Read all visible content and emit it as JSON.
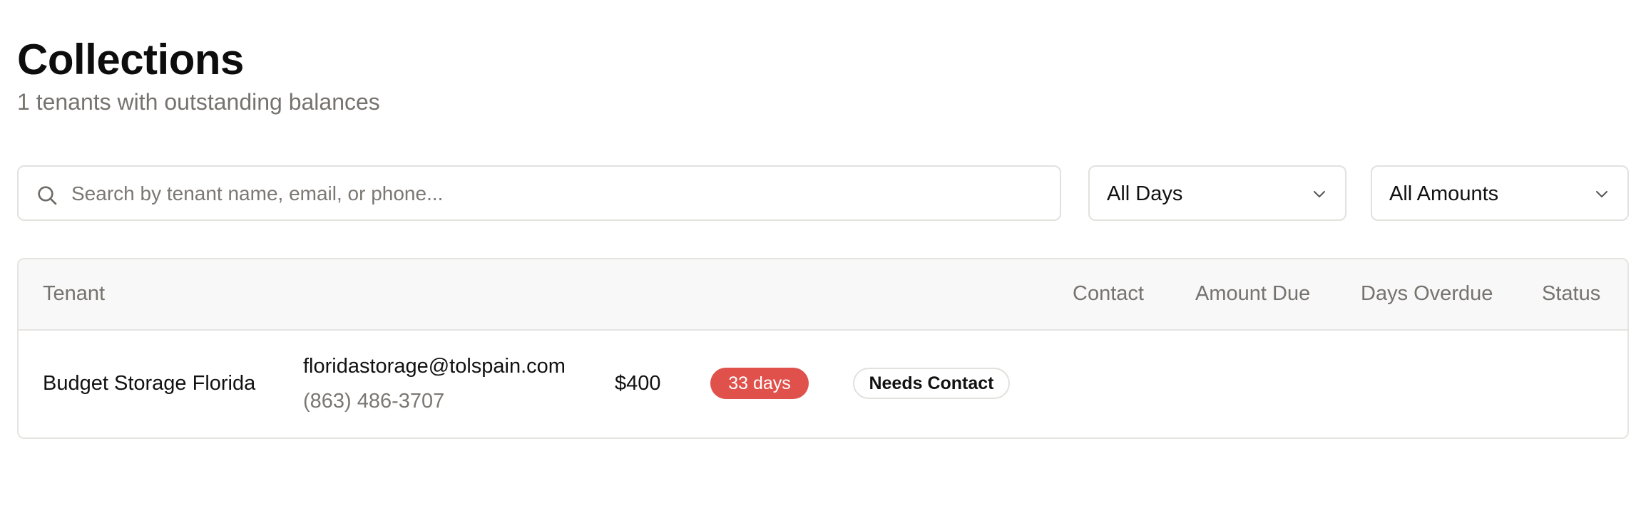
{
  "header": {
    "title": "Collections",
    "subtitle": "1 tenants with outstanding balances"
  },
  "filters": {
    "search_placeholder": "Search by tenant name, email, or phone...",
    "search_icon": "search-icon",
    "days_select": {
      "value": "All Days",
      "icon": "chevron-down-icon"
    },
    "amount_select": {
      "value": "All Amounts",
      "icon": "chevron-down-icon"
    }
  },
  "table": {
    "columns": [
      "Tenant",
      "Contact",
      "Amount Due",
      "Days Overdue",
      "Status"
    ],
    "rows": [
      {
        "tenant": "Budget Storage Florida",
        "email": "floridastorage@tolspain.com",
        "phone": "(863) 486-3707",
        "amount_due": "$400",
        "days_overdue": "33 days",
        "status": "Needs Contact"
      }
    ]
  },
  "colors": {
    "overdue_badge": "#e0514c",
    "muted_text": "#76726e",
    "border": "#e3e1de",
    "header_bg": "#f8f8f8"
  }
}
